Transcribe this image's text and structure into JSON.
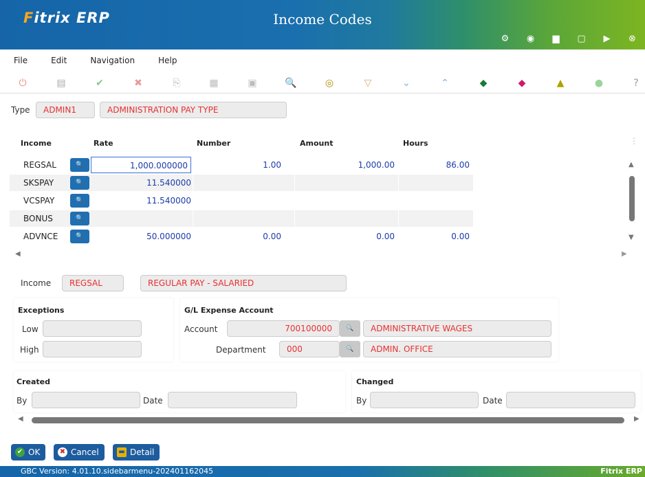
{
  "app": {
    "logo": "Fitrix ERP",
    "title": "Income Codes"
  },
  "titlebar_icons": [
    "gear-icon",
    "globe-icon",
    "document-icon",
    "page-icon",
    "play-icon",
    "close-circle-icon"
  ],
  "menu": [
    "File",
    "Edit",
    "Navigation",
    "Help"
  ],
  "type": {
    "label": "Type",
    "code": "ADMIN1",
    "description": "ADMINISTRATION PAY TYPE"
  },
  "grid": {
    "headers": {
      "income": "Income",
      "rate": "Rate",
      "number": "Number",
      "amount": "Amount",
      "hours": "Hours"
    },
    "rows": [
      {
        "code": "REGSAL",
        "rate": "1,000.000000",
        "number": "1.00",
        "amount": "1,000.00",
        "hours": "86.00"
      },
      {
        "code": "SKSPAY",
        "rate": "11.540000",
        "number": "",
        "amount": "",
        "hours": ""
      },
      {
        "code": "VCSPAY",
        "rate": "11.540000",
        "number": "",
        "amount": "",
        "hours": ""
      },
      {
        "code": "BONUS",
        "rate": "",
        "number": "",
        "amount": "",
        "hours": ""
      },
      {
        "code": "ADVNCE",
        "rate": "50.000000",
        "number": "0.00",
        "amount": "0.00",
        "hours": "0.00"
      }
    ]
  },
  "income": {
    "label": "Income",
    "code": "REGSAL",
    "description": "REGULAR PAY - SALARIED"
  },
  "exceptions": {
    "title": "Exceptions",
    "low_label": "Low",
    "high_label": "High",
    "low": "",
    "high": ""
  },
  "gl": {
    "title": "G/L Expense Account",
    "account_label": "Account",
    "account": "700100000",
    "account_desc": "ADMINISTRATIVE WAGES",
    "dept_label": "Department",
    "dept": "000",
    "dept_desc": "ADMIN. OFFICE"
  },
  "created": {
    "title": "Created",
    "by_label": "By",
    "date_label": "Date",
    "by": "",
    "date": ""
  },
  "changed": {
    "title": "Changed",
    "by_label": "By",
    "date_label": "Date",
    "by": "",
    "date": ""
  },
  "buttons": {
    "ok": "OK",
    "cancel": "Cancel",
    "detail": "Detail"
  },
  "status": {
    "version": "GBC Version: 4.01.10.sidebarmenu-202401162045",
    "brand": "Fitrix ERP"
  },
  "colors": {
    "accent_blue": "#1565a8",
    "accent_green": "#7db521",
    "field_text": "#e83030",
    "value_text": "#1c3ba8"
  }
}
